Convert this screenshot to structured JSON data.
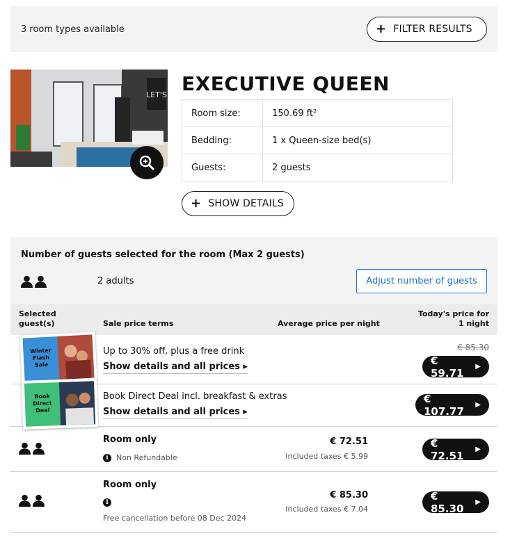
{
  "summary": {
    "room_types_count": "3 room types available",
    "filter_label": "FILTER RESULTS"
  },
  "room": {
    "title": "EXECUTIVE QUEEN",
    "specs": [
      {
        "label": "Room size:",
        "value": "150.69 ft²"
      },
      {
        "label": "Bedding:",
        "value": "1 x Queen-size bed(s)"
      },
      {
        "label": "Guests:",
        "value": "2 guests"
      }
    ],
    "details_label": "SHOW DETAILS",
    "photo_poster_text": "LET'S"
  },
  "guests": {
    "heading": "Number of guests selected for the room (Max 2 guests)",
    "adults": "2 adults",
    "adjust_label": "Adjust number of guests"
  },
  "table_headers": {
    "selected": "Selected guest(s)",
    "terms": "Sale price terms",
    "average": "Average price per night",
    "today": "Today's price for 1 night"
  },
  "rates": [
    {
      "badge": "Winter Flash Sale",
      "term": "Up to 30% off, plus a free drink",
      "link": "Show details and all prices",
      "old_price": "€ 85.30",
      "price": "€ 59.71"
    },
    {
      "badge": "Book Direct Deal",
      "term": "Book Direct Deal incl. breakfast & extras",
      "link": "Show details and all prices",
      "price": "€ 107.77"
    },
    {
      "term": "Room only",
      "note": "Non Refundable",
      "avg": "€ 72.51",
      "tax": "Included taxes € 5.99",
      "price": "€ 72.51"
    },
    {
      "term": "Room only",
      "note": "Free cancellation before 08 Dec 2024",
      "avg": "€ 85.30",
      "tax": "Included taxes € 7.04",
      "price": "€ 85.30"
    }
  ],
  "colors": {
    "accent_blue": "#1a73c9",
    "panel_grey": "#f3f3f3",
    "price_pill": "#111111",
    "badge_blue": "#3b8fd6",
    "badge_green": "#3fc07a"
  }
}
